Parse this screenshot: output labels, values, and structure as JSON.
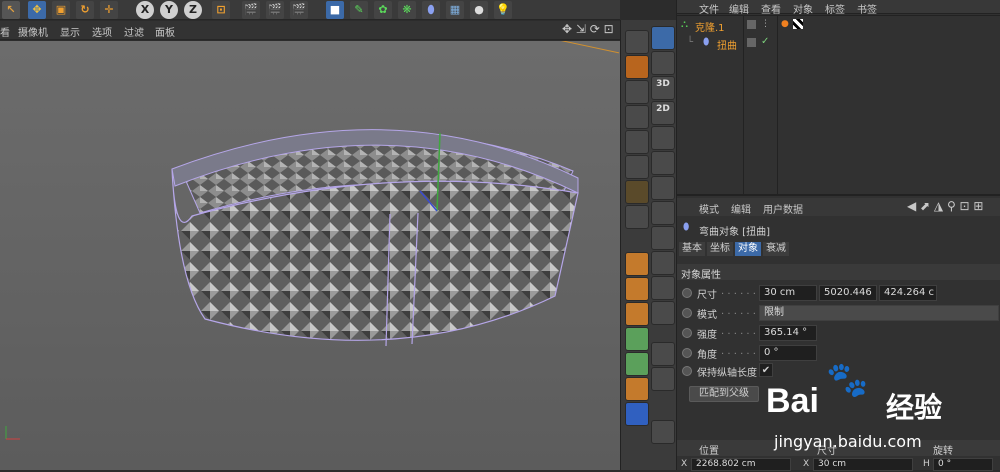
{
  "toolbar": {
    "axis_labels": [
      "X",
      "Y",
      "Z"
    ]
  },
  "viewport_menu": [
    "看",
    "摄像机",
    "显示",
    "选项",
    "过滤",
    "面板"
  ],
  "object_manager": {
    "menu": [
      "文件",
      "编辑",
      "查看",
      "对象",
      "标签",
      "书签"
    ],
    "items": [
      {
        "name": "克隆.1"
      },
      {
        "name": "扭曲"
      }
    ]
  },
  "attributes": {
    "menu": [
      "模式",
      "编辑",
      "用户数据"
    ],
    "object_title": "弯曲对象 [扭曲]",
    "tabs": [
      "基本",
      "坐标",
      "对象",
      "衰减"
    ],
    "active_tab": "对象",
    "section": "对象属性",
    "size_label": "尺寸",
    "size_values": [
      "30 cm",
      "5020.446",
      "424.264 c"
    ],
    "mode_label": "模式",
    "mode_value": "限制",
    "strength_label": "强度",
    "strength_value": "365.14 °",
    "angle_label": "角度",
    "angle_value": "0 °",
    "keep_length_label": "保持纵轴长度",
    "keep_length_check": "✔",
    "match_button": "匹配到父级",
    "coord_headers": [
      "位置",
      "尺寸",
      "旋转"
    ],
    "coord_row": [
      "X",
      "2268.802 cm",
      "X",
      "30 cm",
      "H",
      "0 °"
    ]
  },
  "vtools_labels": [
    "3D",
    "2D"
  ],
  "watermark": {
    "brand_a": "Bai",
    "brand_b": "经验",
    "url": "jingyan.baidu.com"
  }
}
